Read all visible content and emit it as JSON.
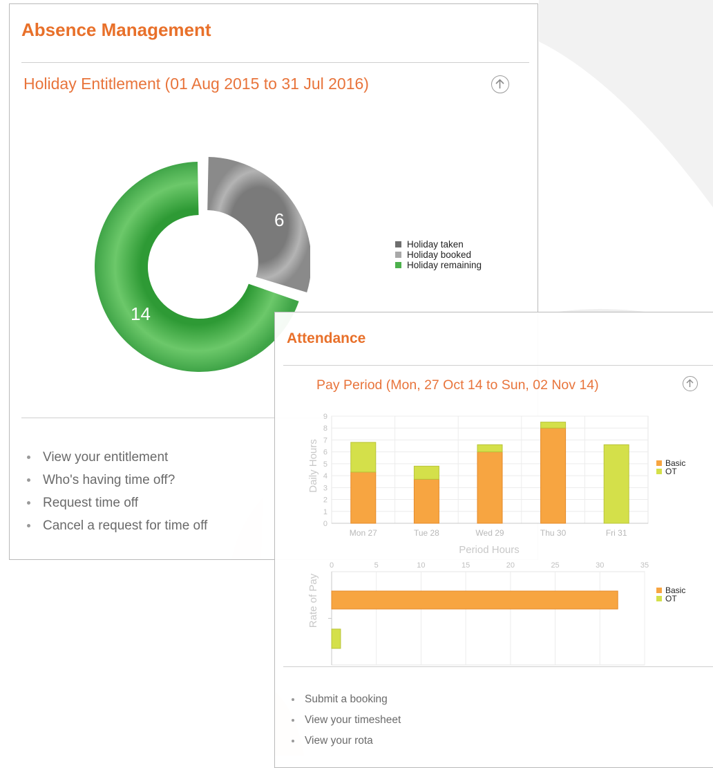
{
  "absence": {
    "title": "Absence Management",
    "subheading": "Holiday Entitlement (01 Aug 2015 to 31 Jul 2016)",
    "links": [
      "View your entitlement",
      "Who's having time off?",
      "Request time off",
      "Cancel a request for time off"
    ]
  },
  "attendance": {
    "title": "Attendance",
    "subheading": "Pay Period (Mon, 27 Oct 14 to Sun, 02 Nov 14)",
    "links": [
      "Submit a booking",
      "View your timesheet",
      "View your rota"
    ]
  },
  "colors": {
    "accent": "#e8702a",
    "holiday_taken": "#6e6e6e",
    "holiday_booked": "#a8a8a8",
    "holiday_remaining": "#4cb04c",
    "basic": "#f7a541",
    "ot": "#d4e04a"
  },
  "chart_data": [
    {
      "type": "pie",
      "variant": "donut",
      "title": "",
      "slices": [
        {
          "name": "Holiday taken",
          "value": 0,
          "color": "#6e6e6e"
        },
        {
          "name": "Holiday booked",
          "value": 6,
          "color": "#a8a8a8"
        },
        {
          "name": "Holiday remaining",
          "value": 14,
          "color": "#4cb04c"
        }
      ],
      "data_labels": [
        "6",
        "14"
      ],
      "legend": [
        "Holiday taken",
        "Holiday booked",
        "Holiday remaining"
      ],
      "legend_position": "right"
    },
    {
      "type": "bar",
      "stacked": true,
      "orientation": "vertical",
      "categories": [
        "Mon 27",
        "Tue 28",
        "Wed 29",
        "Thu 30",
        "Fri 31"
      ],
      "series": [
        {
          "name": "Basic",
          "values": [
            4.3,
            3.7,
            6.0,
            8.0,
            0
          ],
          "color": "#f7a541"
        },
        {
          "name": "OT",
          "values": [
            2.5,
            1.1,
            0.6,
            0.5,
            6.6
          ],
          "color": "#d4e04a"
        }
      ],
      "ylabel": "Daily Hours",
      "ylim": [
        0,
        9
      ],
      "yticks": [
        "0",
        "1",
        "2",
        "3",
        "4",
        "5",
        "6",
        "7",
        "8",
        "9"
      ],
      "legend": [
        "Basic",
        "OT"
      ],
      "legend_position": "right",
      "grid": true
    },
    {
      "type": "bar",
      "orientation": "horizontal",
      "title": "Period Hours",
      "categories": [
        "Basic",
        "OT"
      ],
      "series": [
        {
          "name": "Basic",
          "values": [
            32
          ],
          "color": "#f7a541"
        },
        {
          "name": "OT",
          "values": [
            1
          ],
          "color": "#d4e04a"
        }
      ],
      "ylabel": "Rate of Pay",
      "xlim": [
        0,
        35
      ],
      "xticks": [
        "0",
        "5",
        "10",
        "15",
        "20",
        "25",
        "30",
        "35"
      ],
      "legend": [
        "Basic",
        "OT"
      ],
      "legend_position": "right",
      "grid": true
    }
  ]
}
